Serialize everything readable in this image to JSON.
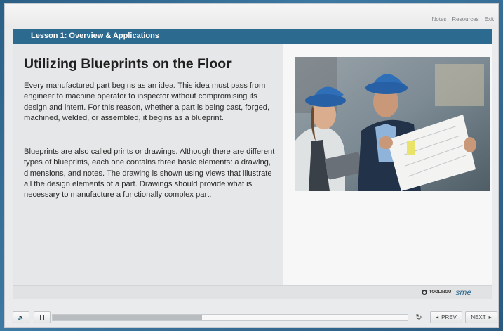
{
  "toplinks": {
    "notes": "Notes",
    "resources": "Resources",
    "exit": "Exit"
  },
  "lesson": {
    "title": "Lesson 1: Overview & Applications"
  },
  "slide": {
    "heading": "Utilizing Blueprints on the Floor",
    "paragraph1": "Every manufactured part begins as an idea. This idea must pass from engineer to machine operator to inspector without compromising its design and intent. For this reason, whether a part is being cast, forged, machined, welded, or assembled, it begins as a blueprint.",
    "paragraph2": "Blueprints are also called prints or drawings. Although there are different types of blueprints, each one contains three basic elements: a drawing, dimensions, and notes. The drawing is shown using views that illustrate all the design elements of a part. Drawings should provide what is necessary to manufacture a functionally complex part."
  },
  "logos": {
    "tooling_u": "TOOLINGU",
    "sme": "sme"
  },
  "controls": {
    "progress_fraction": 0.42,
    "prev_label": "PREV",
    "next_label": "NEXT"
  },
  "colors": {
    "accent": "#2c6a8f",
    "hardhat": "#2f6fb7"
  }
}
